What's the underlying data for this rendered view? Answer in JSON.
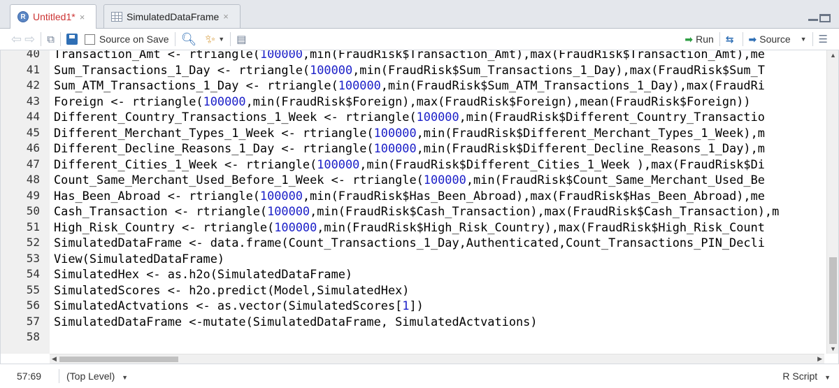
{
  "tabs": [
    {
      "title": "Untitled1*",
      "icon": "r-file-icon",
      "close": "×"
    },
    {
      "title": "SimulatedDataFrame",
      "icon": "data-frame-icon",
      "close": "×"
    }
  ],
  "toolbar": {
    "source_on_save": "Source on Save",
    "run": "Run",
    "source": "Source"
  },
  "editor": {
    "lines": [
      {
        "n": "40",
        "segs": [
          {
            "t": "Transaction_Amt <- rtriangle("
          },
          {
            "t": "100000",
            "c": "num"
          },
          {
            "t": ",min(FraudRisk$Transaction_Amt),max(FraudRisk$Transaction_Amt),me"
          }
        ]
      },
      {
        "n": "41",
        "segs": [
          {
            "t": "Sum_Transactions_1_Day <- rtriangle("
          },
          {
            "t": "100000",
            "c": "num"
          },
          {
            "t": ",min(FraudRisk$Sum_Transactions_1_Day),max(FraudRisk$Sum_T"
          }
        ]
      },
      {
        "n": "42",
        "segs": [
          {
            "t": "Sum_ATM_Transactions_1_Day <- rtriangle("
          },
          {
            "t": "100000",
            "c": "num"
          },
          {
            "t": ",min(FraudRisk$Sum_ATM_Transactions_1_Day),max(FraudRi"
          }
        ]
      },
      {
        "n": "43",
        "segs": [
          {
            "t": "Foreign <- rtriangle("
          },
          {
            "t": "100000",
            "c": "num"
          },
          {
            "t": ",min(FraudRisk$Foreign),max(FraudRisk$Foreign),mean(FraudRisk$Foreign))"
          }
        ]
      },
      {
        "n": "44",
        "segs": [
          {
            "t": "Different_Country_Transactions_1_Week <- rtriangle("
          },
          {
            "t": "100000",
            "c": "num"
          },
          {
            "t": ",min(FraudRisk$Different_Country_Transactio"
          }
        ]
      },
      {
        "n": "45",
        "segs": [
          {
            "t": "Different_Merchant_Types_1_Week <- rtriangle("
          },
          {
            "t": "100000",
            "c": "num"
          },
          {
            "t": ",min(FraudRisk$Different_Merchant_Types_1_Week),m"
          }
        ]
      },
      {
        "n": "46",
        "segs": [
          {
            "t": "Different_Decline_Reasons_1_Day <- rtriangle("
          },
          {
            "t": "100000",
            "c": "num"
          },
          {
            "t": ",min(FraudRisk$Different_Decline_Reasons_1_Day),m"
          }
        ]
      },
      {
        "n": "47",
        "segs": [
          {
            "t": "Different_Cities_1_Week <- rtriangle("
          },
          {
            "t": "100000",
            "c": "num"
          },
          {
            "t": ",min(FraudRisk$Different_Cities_1_Week ),max(FraudRisk$Di"
          }
        ]
      },
      {
        "n": "48",
        "segs": [
          {
            "t": "Count_Same_Merchant_Used_Before_1_Week <- rtriangle("
          },
          {
            "t": "100000",
            "c": "num"
          },
          {
            "t": ",min(FraudRisk$Count_Same_Merchant_Used_Be"
          }
        ]
      },
      {
        "n": "49",
        "segs": [
          {
            "t": "Has_Been_Abroad <- rtriangle("
          },
          {
            "t": "100000",
            "c": "num"
          },
          {
            "t": ",min(FraudRisk$Has_Been_Abroad),max(FraudRisk$Has_Been_Abroad),me"
          }
        ]
      },
      {
        "n": "50",
        "segs": [
          {
            "t": "Cash_Transaction <- rtriangle("
          },
          {
            "t": "100000",
            "c": "num"
          },
          {
            "t": ",min(FraudRisk$Cash_Transaction),max(FraudRisk$Cash_Transaction),m"
          }
        ]
      },
      {
        "n": "51",
        "segs": [
          {
            "t": "High_Risk_Country <- rtriangle("
          },
          {
            "t": "100000",
            "c": "num"
          },
          {
            "t": ",min(FraudRisk$High_Risk_Country),max(FraudRisk$High_Risk_Count"
          }
        ]
      },
      {
        "n": "52",
        "segs": [
          {
            "t": "SimulatedDataFrame <- data.frame(Count_Transactions_1_Day,Authenticated,Count_Transactions_PIN_Decli"
          }
        ]
      },
      {
        "n": "53",
        "segs": [
          {
            "t": "View(SimulatedDataFrame)"
          }
        ]
      },
      {
        "n": "54",
        "segs": [
          {
            "t": "SimulatedHex <- as.h2o(SimulatedDataFrame)"
          }
        ]
      },
      {
        "n": "55",
        "segs": [
          {
            "t": "SimulatedScores <- h2o.predict(Model,SimulatedHex)"
          }
        ]
      },
      {
        "n": "56",
        "segs": [
          {
            "t": "SimulatedActvations <- as.vector(SimulatedScores["
          },
          {
            "t": "1",
            "c": "num"
          },
          {
            "t": "])"
          }
        ]
      },
      {
        "n": "57",
        "segs": [
          {
            "t": "SimulatedDataFrame <-mutate(SimulatedDataFrame, SimulatedActvations)"
          }
        ]
      },
      {
        "n": "58",
        "segs": [
          {
            "t": ""
          }
        ]
      }
    ]
  },
  "status": {
    "position": "57:69",
    "scope": "(Top Level)",
    "file_type": "R Script"
  },
  "colors": {
    "number": "#1c20c8",
    "modified_tab_title": "#c33"
  }
}
